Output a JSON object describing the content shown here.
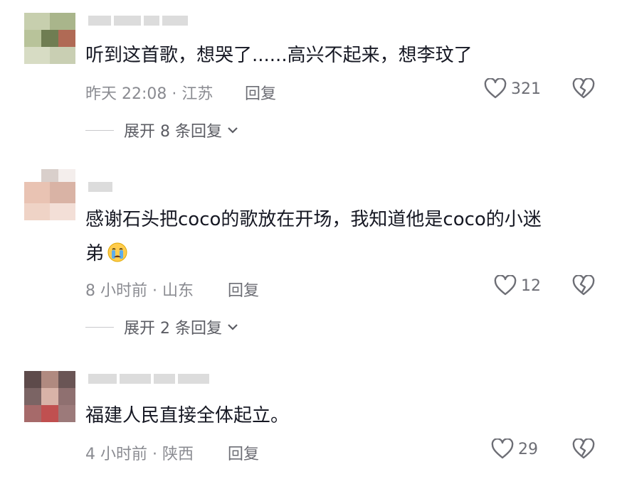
{
  "comments": [
    {
      "text": "听到这首歌，想哭了......高兴不起来，想李玟了",
      "time_location": "昨天 22:08 · 江苏",
      "reply_label": "回复",
      "likes": "321",
      "expand_label": "展开 8 条回复"
    },
    {
      "text_line1": "感谢石头把coco的歌放在开场，我知道他是coco的小迷",
      "text_line2": "弟",
      "time_location": "8 小时前 · 山东",
      "reply_label": "回复",
      "likes": "12",
      "expand_label": "展开 2 条回复"
    },
    {
      "text": "福建人民直接全体起立。",
      "time_location": "4 小时前 · 陕西",
      "reply_label": "回复",
      "likes": "29"
    }
  ],
  "icons": {
    "like": "heart-outline-icon",
    "dislike": "broken-heart-icon",
    "expand": "chevron-down-icon",
    "emoji": "crying-face-emoji"
  }
}
